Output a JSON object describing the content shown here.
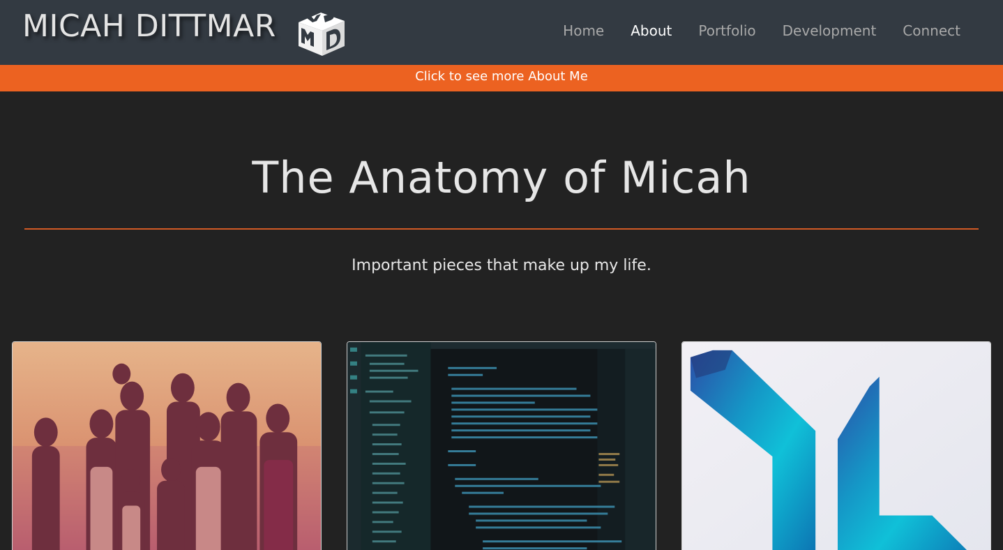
{
  "brand": {
    "title": "MICAH DITTMAR",
    "logo_text": "MD"
  },
  "nav": {
    "items": [
      {
        "label": "Home",
        "active": false
      },
      {
        "label": "About",
        "active": true
      },
      {
        "label": "Portfolio",
        "active": false
      },
      {
        "label": "Development",
        "active": false
      },
      {
        "label": "Connect",
        "active": false
      }
    ]
  },
  "banner": {
    "label": "Click to see more About Me",
    "color": "#ec6221"
  },
  "hero": {
    "title": "The Anatomy of Micah",
    "subtitle": "Important pieces that make up my life."
  },
  "cards": [
    {
      "id": "family",
      "icon": "family-photo"
    },
    {
      "id": "code",
      "icon": "code-editor-screenshot"
    },
    {
      "id": "logo",
      "icon": "yl-logo"
    }
  ],
  "colors": {
    "navbar": "#333a42",
    "background": "#222222",
    "accent": "#ec6221"
  }
}
